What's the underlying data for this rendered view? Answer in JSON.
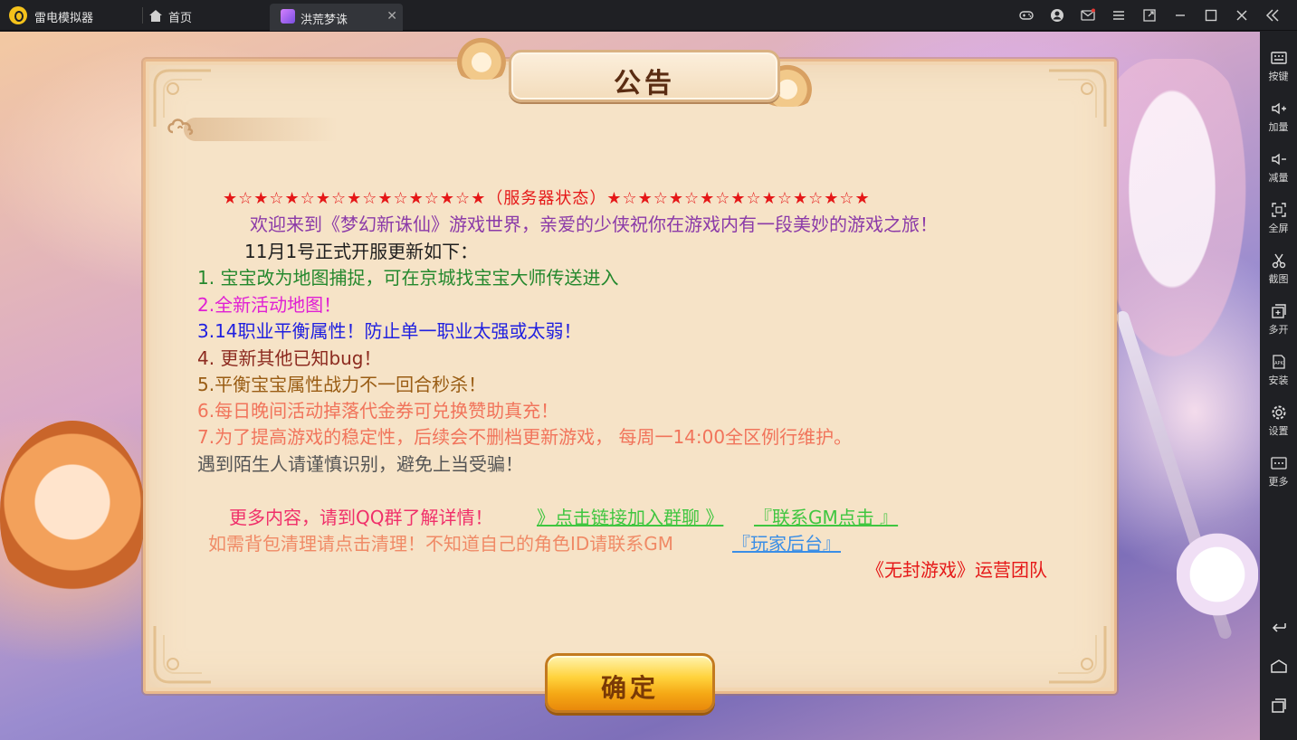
{
  "titlebar": {
    "app_title": "雷电模拟器",
    "home_tab": "首页",
    "game_tab": "洪荒梦诛",
    "tab_close": "✕",
    "icons": [
      "gamepad-icon",
      "user-icon",
      "mail-icon",
      "menu-icon",
      "resize-icon",
      "minimize-icon",
      "maximize-icon",
      "close-icon",
      "collapse-sidebar-icon"
    ]
  },
  "sidebar": {
    "items": [
      {
        "label": "按键",
        "icon": "keyboard-icon"
      },
      {
        "label": "加量",
        "icon": "volume-up-icon"
      },
      {
        "label": "减量",
        "icon": "volume-down-icon"
      },
      {
        "label": "全屏",
        "icon": "fullscreen-icon"
      },
      {
        "label": "截图",
        "icon": "scissors-icon"
      },
      {
        "label": "多开",
        "icon": "multi-instance-icon"
      },
      {
        "label": "安装",
        "icon": "apk-icon"
      },
      {
        "label": "设置",
        "icon": "gear-icon"
      },
      {
        "label": "更多",
        "icon": "more-icon"
      }
    ],
    "nav": [
      "back-icon",
      "home-icon",
      "recent-apps-icon"
    ]
  },
  "notice": {
    "title": "公告",
    "stars_line": "★☆★☆★☆★☆★☆★☆★☆★☆★（服务器状态）★☆★☆★☆★☆★☆★☆★☆★☆★",
    "welcome": "欢迎来到《梦幻新诛仙》游戏世界，亲爱的少侠祝你在游戏内有一段美妙的游戏之旅！",
    "subhead": "11月1号正式开服更新如下：",
    "items": [
      "1. 宝宝改为地图捕捉，可在京城找宝宝大师传送进入",
      "2.全新活动地图！",
      "3.14职业平衡属性！防止单一职业太强或太弱！",
      "4. 更新其他已知bug！",
      "5.平衡宝宝属性战力不一回合秒杀！",
      "6.每日晚间活动掉落代金券可兑换赞助真充！",
      "7.为了提高游戏的稳定性，后续会不删档更新游戏， 每周一14:00全区例行维护。",
      "遇到陌生人请谨慎识别，避免上当受骗！"
    ],
    "more_info": "更多内容，请到QQ群了解详情！",
    "link_group": "》点击链接加入群聊 》",
    "link_gm": "『联系GM点击 』",
    "clean_text": "如需背包清理请点击清理！不知道自己的角色ID请联系GM",
    "link_admin": "『玩家后台』",
    "team": "《无封游戏》运营团队",
    "confirm": "确定"
  },
  "colors": {
    "panel_bg": "#f6e3c7",
    "stars": "#e51818",
    "welcome": "#8b3aa8",
    "item1": "#24882d",
    "item2": "#e020d4",
    "item3": "#1f1fe0",
    "item4": "#8c2a1f",
    "item5": "#9a5d14",
    "item6_7": "#f1745b",
    "link_green": "#40c640",
    "link_blue": "#3a8ee6",
    "more": "#f0306a"
  }
}
